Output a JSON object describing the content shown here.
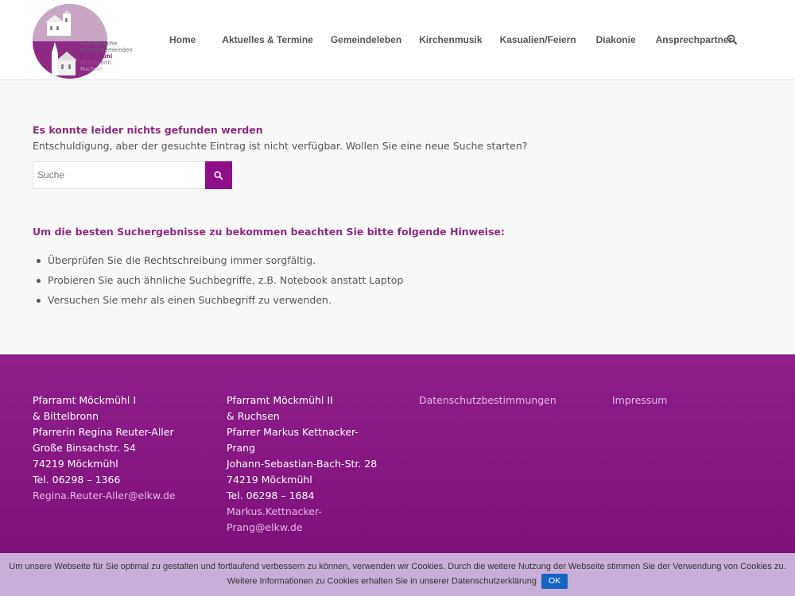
{
  "logo": {
    "line1": "Evangelische",
    "line2": "Kirchengemeinden",
    "line3": "Möckmühl",
    "line4": "Bittelbronn",
    "line5": "Ruchsen"
  },
  "nav": {
    "items": [
      "Home",
      "Aktuelles & Termine",
      "Gemeindeleben",
      "Kirchenmusik",
      "Kasualien/Feiern",
      "Diakonie",
      "Ansprechpartner"
    ]
  },
  "main": {
    "not_found_title": "Es konnte leider nichts gefunden werden",
    "sorry_text": "Entschuldigung, aber der gesuchte Eintrag ist nicht verfügbar. Wollen Sie eine neue Suche starten?",
    "search_placeholder": "Suche",
    "hints_title": "Um die besten Suchergebnisse zu bekommen beachten Sie bitte folgende Hinweise:",
    "hints": [
      "Überprüfen Sie die Rechtschreibung immer sorgfältig.",
      "Probieren Sie auch ähnliche Suchbegriffe, z.B. Notebook anstatt Laptop",
      "Versuchen Sie mehr als einen Suchbegriff zu verwenden."
    ]
  },
  "footer": {
    "col1": {
      "lines": [
        "Pfarramt Möckmühl I",
        "& Bittelbronn",
        "Pfarrerin Regina Reuter-Aller",
        "Große Binsachstr. 54",
        "74219 Möckmühl",
        "Tel. 06298 – 1366"
      ],
      "email": "Regina.Reuter-Aller@elkw.de"
    },
    "col2": {
      "lines": [
        "Pfarramt Möckmühl II",
        "& Ruchsen",
        "Pfarrer Markus Kettnacker-",
        "Prang",
        "Johann-Sebastian-Bach-Str. 28",
        "74219 Möckmühl",
        "Tel. 06298 – 1684"
      ],
      "email_line1": "Markus.Kettnacker-",
      "email_line2": "Prang@elkw.de"
    },
    "col3": "Datenschutzbestimmungen",
    "col4": "Impressum"
  },
  "cookie": {
    "text": "Um unsere Webseite für Sie optimal zu gestalten und fortlaufend verbessern zu können, verwenden wir Cookies. Durch die weitere Nutzung der Webseite stimmen Sie der Verwendung von Cookies zu. Weitere Informationen zu Cookies erhalten Sie in unserer Datenschutzerklärung",
    "ok_label": "OK"
  },
  "colors": {
    "accent": "#8d2a84",
    "footer": "#841480",
    "ok_button": "#1565c0"
  }
}
